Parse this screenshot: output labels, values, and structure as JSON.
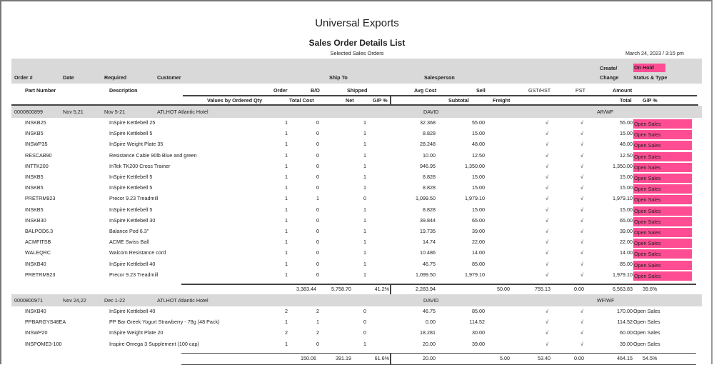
{
  "report": {
    "company": "Universal Exports",
    "title": "Sales Order Details List",
    "subtitle": "Selected Sales Orders",
    "date": "March 24, 2023  /  3:15 pm"
  },
  "headers": {
    "order_no": "Order #",
    "date": "Date",
    "required": "Required",
    "customer": "Customer",
    "ship_to": "Ship To",
    "salesperson": "Salesperson",
    "create": "Create/",
    "change": "Change",
    "on_hold": "On Hold",
    "status_type": "Status & Type",
    "part_number": "Part Number",
    "description": "Description",
    "order": "Order",
    "bo": "B/O",
    "shipped": "Shipped",
    "avg_cost": "Avg Cost",
    "sell": "Sell",
    "gst": "GST/HST",
    "pst": "PST",
    "amount": "Amount",
    "values_by": "Values by Ordered Qty",
    "total_cost": "Total Cost",
    "net": "Net",
    "gp": "G/P %",
    "subtotal": "Subtotal",
    "freight": "Freight",
    "total": "Total",
    "gp2": "G/P %"
  },
  "colors": {
    "highlight": "#ff4d94",
    "band": "#d9d9d9"
  },
  "check_symbol": "√",
  "orders": [
    {
      "number": "0000800899",
      "date": "Nov 5,21",
      "required": "Nov 5-21",
      "customer": "ATLHOT Atlantic Hotel",
      "salesperson": "DAVID",
      "create_change": "AR/WF",
      "highlighted": true,
      "lines": [
        {
          "part": "INSKB25",
          "desc": "InSpire Kettlebell 25",
          "order": "1",
          "bo": "0",
          "shipped": "1",
          "avg_cost": "32.368",
          "sell": "55.00",
          "gst": "√",
          "pst": "√",
          "amount": "55.00",
          "status": "Open Sales"
        },
        {
          "part": "INSKB5",
          "desc": "InSpire Kettlebell 5",
          "order": "1",
          "bo": "0",
          "shipped": "1",
          "avg_cost": "8.828",
          "sell": "15.00",
          "gst": "√",
          "pst": "√",
          "amount": "15.00",
          "status": "Open Sales"
        },
        {
          "part": "INSWP35",
          "desc": "InSpire Weight Plate 35",
          "order": "1",
          "bo": "0",
          "shipped": "1",
          "avg_cost": "28.248",
          "sell": "48.00",
          "gst": "√",
          "pst": "√",
          "amount": "48.00",
          "status": "Open Sales"
        },
        {
          "part": "RESCAB90",
          "desc": "Resistance Cable 90lb Blue and green",
          "order": "1",
          "bo": "0",
          "shipped": "1",
          "avg_cost": "10.00",
          "sell": "12.50",
          "gst": "√",
          "pst": "√",
          "amount": "12.50",
          "status": "Open Sales"
        },
        {
          "part": "INTTK200",
          "desc": "InTek TK200 Cross Trainer",
          "order": "1",
          "bo": "0",
          "shipped": "1",
          "avg_cost": "946.95",
          "sell": "1,350.00",
          "gst": "√",
          "pst": "√",
          "amount": "1,350.00",
          "status": "Open Sales"
        },
        {
          "part": "INSKB5",
          "desc": "InSpire Kettlebell 5",
          "order": "1",
          "bo": "0",
          "shipped": "1",
          "avg_cost": "8.828",
          "sell": "15.00",
          "gst": "√",
          "pst": "√",
          "amount": "15.00",
          "status": "Open Sales"
        },
        {
          "part": "INSKB5",
          "desc": "InSpire Kettlebell 5",
          "order": "1",
          "bo": "0",
          "shipped": "1",
          "avg_cost": "8.828",
          "sell": "15.00",
          "gst": "√",
          "pst": "√",
          "amount": "15.00",
          "status": "Open Sales"
        },
        {
          "part": "PRETRM923",
          "desc": "Precor 9.23 Treadmill",
          "order": "1",
          "bo": "1",
          "shipped": "0",
          "avg_cost": "1,099.50",
          "sell": "1,979.10",
          "gst": "√",
          "pst": "√",
          "amount": "1,979.10",
          "status": "Open Sales"
        },
        {
          "part": "INSKB5",
          "desc": "InSpire Kettlebell 5",
          "order": "1",
          "bo": "0",
          "shipped": "1",
          "avg_cost": "8.828",
          "sell": "15.00",
          "gst": "√",
          "pst": "√",
          "amount": "15.00",
          "status": "Open Sales"
        },
        {
          "part": "INSKB30",
          "desc": "InSpire Kettlebell 30",
          "order": "1",
          "bo": "0",
          "shipped": "1",
          "avg_cost": "39.844",
          "sell": "65.00",
          "gst": "√",
          "pst": "√",
          "amount": "65.00",
          "status": "Open Sales"
        },
        {
          "part": "BALPOD6.3",
          "desc": "Balance Pod 6.3\"",
          "order": "1",
          "bo": "0",
          "shipped": "1",
          "avg_cost": "19.735",
          "sell": "39.00",
          "gst": "√",
          "pst": "√",
          "amount": "39.00",
          "status": "Open Sales"
        },
        {
          "part": "ACMFITSB",
          "desc": "ACME Swiss Ball",
          "order": "1",
          "bo": "0",
          "shipped": "1",
          "avg_cost": "14.74",
          "sell": "22.00",
          "gst": "√",
          "pst": "√",
          "amount": "22.00",
          "status": "Open Sales"
        },
        {
          "part": "WALEQRC",
          "desc": "Walcom Resistance cord",
          "order": "1",
          "bo": "0",
          "shipped": "1",
          "avg_cost": "10.486",
          "sell": "14.00",
          "gst": "√",
          "pst": "√",
          "amount": "14.00",
          "status": "Open Sales"
        },
        {
          "part": "INSKB40",
          "desc": "InSpire Kettlebell 40",
          "order": "1",
          "bo": "0",
          "shipped": "1",
          "avg_cost": "46.75",
          "sell": "85.00",
          "gst": "√",
          "pst": "√",
          "amount": "85.00",
          "status": "Open Sales"
        },
        {
          "part": "PRETRM923",
          "desc": "Precor 9.23 Treadmill",
          "order": "1",
          "bo": "0",
          "shipped": "1",
          "avg_cost": "1,099.50",
          "sell": "1,979.10",
          "gst": "√",
          "pst": "√",
          "amount": "1,979.10",
          "status": "Open Sales"
        }
      ],
      "totals": {
        "total_cost": "3,383.44",
        "net": "5,758.70",
        "gp": "41.2%",
        "subtotal": "2,283.94",
        "freight": "50.00",
        "gst": "755.13",
        "pst": "0.00",
        "total": "6,563.83",
        "gp2": "39.6%"
      }
    },
    {
      "number": "0000800971",
      "date": "Nov 24,22",
      "required": "Dec 1-22",
      "customer": "ATLHOT Atlantic Hotel",
      "salesperson": "DAVID",
      "create_change": "WF/WF",
      "highlighted": false,
      "lines": [
        {
          "part": "INSKB40",
          "desc": "InSpire Kettlebell 40",
          "order": "2",
          "bo": "2",
          "shipped": "0",
          "avg_cost": "46.75",
          "sell": "85.00",
          "gst": "√",
          "pst": "√",
          "amount": "170.00",
          "status": "Open Sales"
        },
        {
          "part": "PPBARGYS48EA",
          "desc": "PP Bar Greek Yogurt Strawberry - 78g (48 Pack)",
          "order": "1",
          "bo": "1",
          "shipped": "0",
          "avg_cost": "0.00",
          "sell": "114.52",
          "gst": "√",
          "pst": "√",
          "amount": "114.52",
          "status": "Open Sales"
        },
        {
          "part": "INSWP20",
          "desc": "InSpire Weight Plate 20",
          "order": "2",
          "bo": "2",
          "shipped": "0",
          "avg_cost": "18.281",
          "sell": "30.00",
          "gst": "√",
          "pst": "√",
          "amount": "60.00",
          "status": "Open Sales"
        },
        {
          "part": "INSPOME3-100",
          "desc": "Inspire Omega 3 Supplement  (100 cap)",
          "order": "1",
          "bo": "0",
          "shipped": "1",
          "avg_cost": "20.00",
          "sell": "39.00",
          "gst": "√",
          "pst": "√",
          "amount": "39.00",
          "status": "Open Sales"
        }
      ],
      "totals": {
        "total_cost": "150.06",
        "net": "391.19",
        "gp": "61.6%",
        "subtotal": "20.00",
        "freight": "5.00",
        "gst": "53.40",
        "pst": "0.00",
        "total": "464.15",
        "gp2": "54.5%"
      }
    }
  ]
}
